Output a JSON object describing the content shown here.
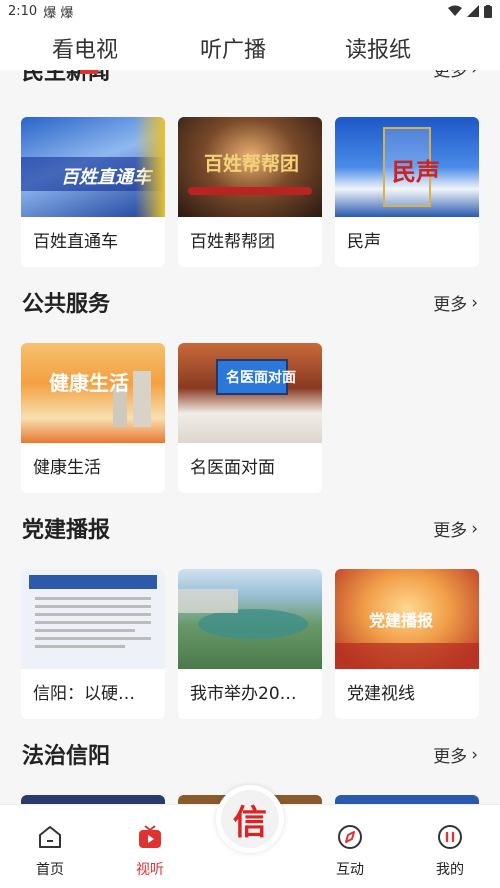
{
  "status_bar": {
    "time": "2:10",
    "notif_icons": "爆 爆"
  },
  "top_tabs": [
    "看电视",
    "听广播",
    "读报纸"
  ],
  "sections": [
    {
      "title": "民生新闻",
      "more": "更多",
      "cards": [
        {
          "label": "百姓直通车",
          "thumb_text": "百姓直通车"
        },
        {
          "label": "百姓帮帮团",
          "thumb_text": "百姓帮帮团"
        },
        {
          "label": "民声",
          "thumb_text": "民声"
        }
      ]
    },
    {
      "title": "公共服务",
      "more": "更多",
      "cards": [
        {
          "label": "健康生活",
          "thumb_text": "健康生活"
        },
        {
          "label": "名医面对面",
          "thumb_text": "名医面对面"
        }
      ]
    },
    {
      "title": "党建播报",
      "more": "更多",
      "cards": [
        {
          "label": "信阳：以硬…",
          "thumb_text": ""
        },
        {
          "label": "我市举办20…",
          "thumb_text": ""
        },
        {
          "label": "党建视线",
          "thumb_text": "党建播报"
        }
      ]
    },
    {
      "title": "法治信阳",
      "more": "更多"
    }
  ],
  "bottom_nav": [
    {
      "label": "首页",
      "icon": "home-icon"
    },
    {
      "label": "视听",
      "icon": "tv-icon"
    },
    {
      "label": "互动",
      "icon": "compass-icon"
    },
    {
      "label": "我的",
      "icon": "profile-icon"
    }
  ],
  "center_logo": "信",
  "colors": {
    "accent": "#d33333",
    "background": "#f6f6f6"
  }
}
